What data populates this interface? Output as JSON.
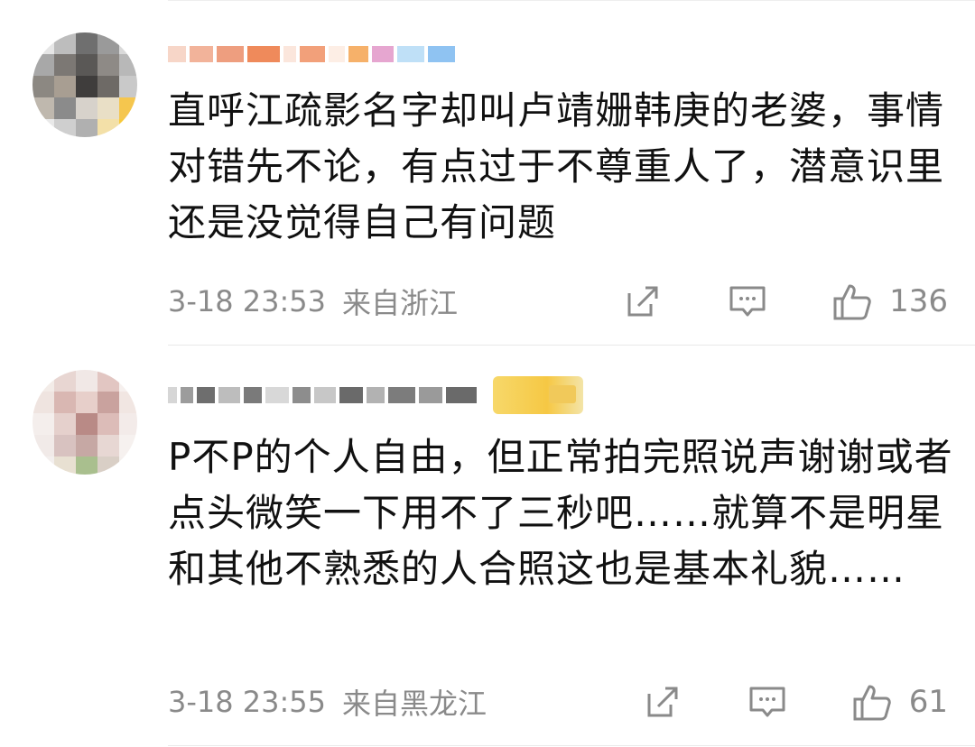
{
  "comments": [
    {
      "text": "直呼江疏影名字却叫卢靖姗韩庚的老婆，事情对错先不论，有点过于不尊重人了，潜意识里还是没觉得自己有问题",
      "time": "3-18 23:53",
      "region": "来自浙江",
      "likes": "136",
      "icons": {
        "repost": "share-edit-icon",
        "comment": "comment-bubble-icon",
        "like": "thumbs-up-icon"
      }
    },
    {
      "text": "P不P的个人自由，但正常拍完照说声谢谢或者点头微笑一下用不了三秒吧……就算不是明星和其他不熟悉的人合照这也是基本礼貌……",
      "time": "3-18 23:55",
      "region": "来自黑龙江",
      "likes": "61",
      "icons": {
        "repost": "share-edit-icon",
        "comment": "comment-bubble-icon",
        "like": "thumbs-up-icon"
      }
    }
  ],
  "colors": {
    "text": "#111111",
    "meta": "#8a8a8a",
    "divider": "#e9e9e9"
  }
}
